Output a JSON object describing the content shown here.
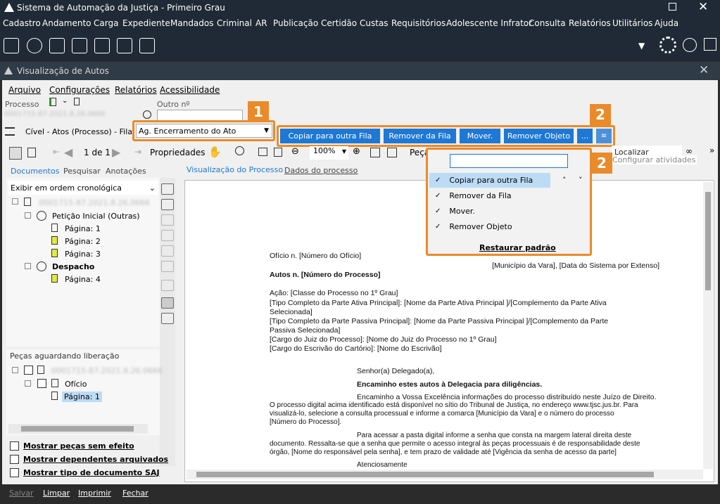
{
  "app": {
    "title": "Sistema de Automação da Justiça - Primeiro Grau",
    "menu": [
      "Cadastro",
      "Andamento",
      "Carga",
      "Expediente",
      "Mandados",
      "Criminal",
      "AR",
      "Publicação",
      "Certidão",
      "Custas",
      "Requisitórios",
      "Adolescente Infrator",
      "Consulta",
      "Relatórios",
      "Utilitários",
      "Ajuda"
    ]
  },
  "window": {
    "title": "Visualização de Autos",
    "menu": [
      "Arquivo",
      "Configurações",
      "Relatórios",
      "Acessibilidade"
    ],
    "processo_label": "Processo",
    "processo_value": "0001715-87.2021.8.26.0666",
    "outro_label": "Outro nº",
    "outro_value": "",
    "queue_prefix": "Cível - Atos (Processo) - Fila:",
    "queue_value": "Ag. Encerramento do Ato"
  },
  "context_buttons": [
    "Copiar para outra Fila",
    "Remover da Fila",
    "Mover.",
    "Remover Objeto",
    "..."
  ],
  "badges": {
    "b1": "1",
    "b2": "2",
    "b3": "2"
  },
  "toolbar": {
    "page_label": "1 de 1",
    "props": "Propriedades",
    "zoom": "100%",
    "pecas": "Peça",
    "localizar": "Localizar",
    "tooltip": "Configurar atividades"
  },
  "left_tabs": [
    "Documentos",
    "Pesquisar",
    "Anotações"
  ],
  "order_select": "Exibir em ordem cronológica",
  "tree": {
    "root": "0001715-87.2021.8.26.0666",
    "peticao": "Petição Inicial (Outras)",
    "pages": [
      "Página: 1",
      "Página: 2",
      "Página: 3"
    ],
    "despacho": "Despacho",
    "despacho_page": "Página: 4"
  },
  "pending": {
    "header": "Peças aguardando liberação",
    "root": "0001715-87.2021.8.26.0666",
    "oficio": "Ofício",
    "page": "Página: 1"
  },
  "checkboxes": [
    "Mostrar peças sem efeito",
    "Mostrar dependentes arquivados",
    "Mostrar tipo de documento SAJ"
  ],
  "view_tabs": [
    "Visualização do Processo",
    "Dados do processo"
  ],
  "dropdown": {
    "search": "",
    "items": [
      "Copiar para outra Fila",
      "Remover da Fila",
      "Mover.",
      "Remover Objeto"
    ],
    "restore": "Restaurar padrão"
  },
  "document": {
    "l1": "Ofício n. [Número do Ofício]",
    "l2": "[Município da Vara], [Data do Sistema por Extenso]",
    "l3": "Autos n. [Número do Processo]",
    "l4": "Ação: [Classe do Processo no 1º Grau]",
    "l5": "[Tipo Completo da Parte Ativa Principal]: [Nome da Parte Ativa Principal ]/[Complemento da Parte Ativa",
    "l6": "Selecionada]",
    "l7": "[Tipo Completo da Parte Passiva Principal]: [Nome da Parte Passiva Principal ]/[Complemento da Parte",
    "l8": "Passiva Selecionada]",
    "l9": "[Cargo do Juiz do Processo]: [Nome do Juiz do Processo no 1º Grau]",
    "l10": "[Cargo do Escrivão do Cartório]: [Nome do Escrivão]",
    "l11": "Senhor(a) Delegado(a),",
    "l12": "Encaminho estes autos à Delegacia para diligências.",
    "l13": "Encaminho a Vossa Excelência informações do processo distribuído neste Juízo de Direito.",
    "l14": "O processo digital acima identificado está disponível no sítio do Tribunal de Justiça, no endereço www.tjsc.jus.br. Para",
    "l15": "visualizá-lo, selecione a consulta processual e informe a comarca  [Município da Vara] e o número do processo",
    "l16": "[Número do Processo].",
    "l17": "Para acessar a pasta digital informe a senha que consta na margem lateral direita deste",
    "l18": "documento. Ressalta-se que a senha que permite o acesso integral às peças processuais é de responsabilidade deste",
    "l19": "órgão, [Nome do responsável pela senha], e tem prazo de validade até [Vigência da senha de acesso da parte]",
    "l20": "Atenciosamente"
  },
  "bottom": [
    "Salvar",
    "Limpar",
    "Imprimir",
    "Fechar"
  ],
  "colors": {
    "accent": "#1e78d4",
    "badge": "#e98b2a",
    "chrome": "#1f2a36"
  }
}
